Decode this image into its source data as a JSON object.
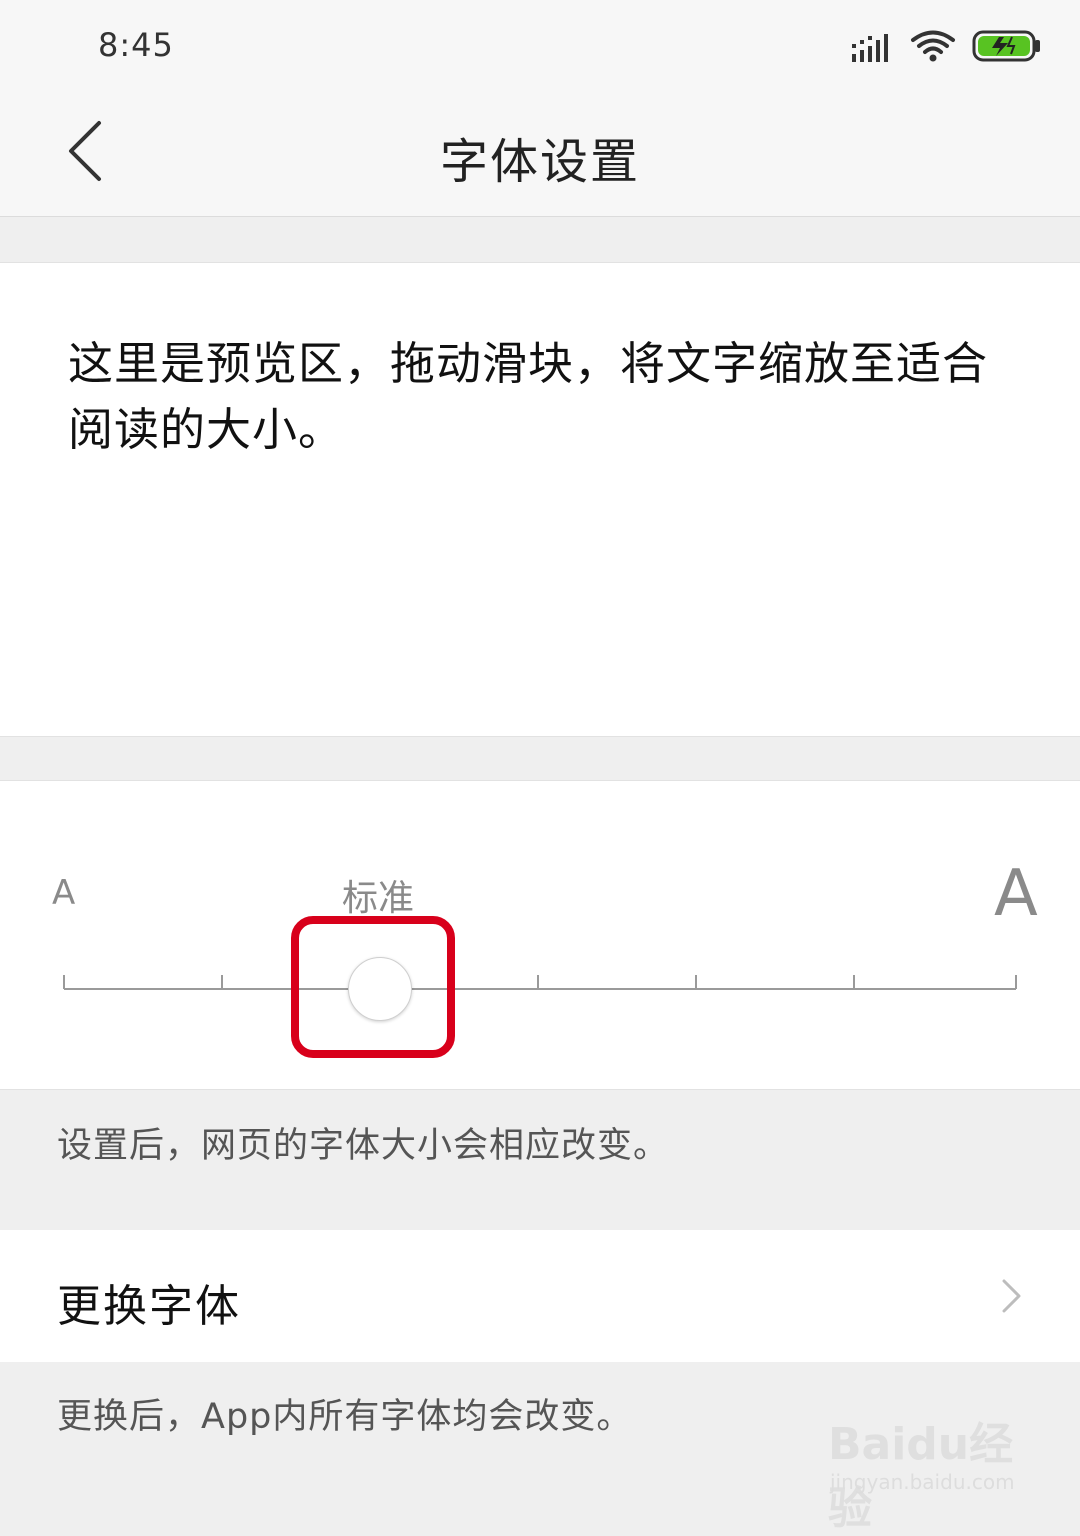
{
  "status": {
    "time": "8:45"
  },
  "nav": {
    "title": "字体设置"
  },
  "preview": {
    "text": "这里是预览区，拖动滑块，将文字缩放至适合阅读的大小。"
  },
  "slider": {
    "small_label": "A",
    "standard_label": "标准",
    "large_label": "A",
    "steps": 7,
    "selected_index": 2
  },
  "hints": {
    "webpage_hint": "设置后，网页的字体大小会相应改变。",
    "font_change_hint": "更换后，App内所有字体均会改变。"
  },
  "font_row": {
    "label": "更换字体"
  },
  "watermark": {
    "logo": "Baidu经验",
    "url": "jingyan.baidu.com"
  },
  "colors": {
    "highlight": "#d8001b",
    "battery": "#58c322"
  }
}
